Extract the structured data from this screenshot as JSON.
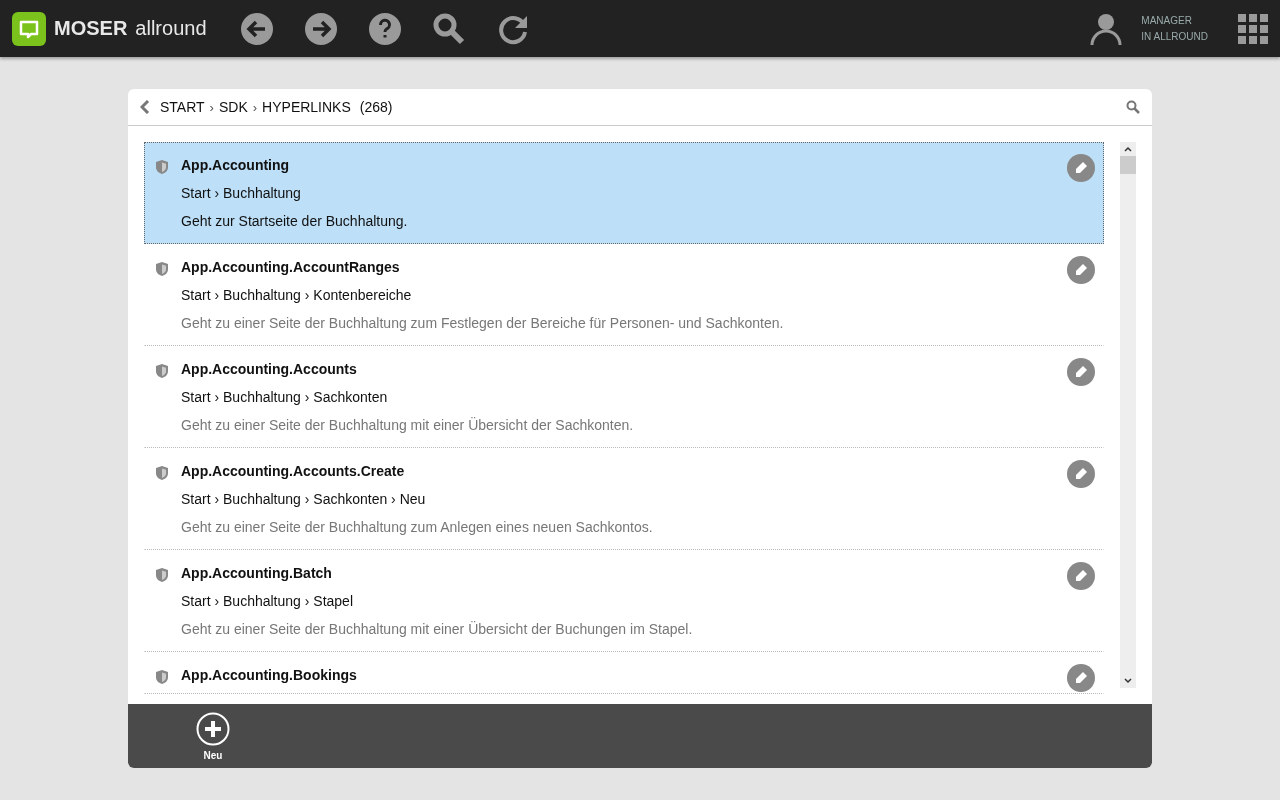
{
  "app": {
    "brand": "MOSER",
    "product": "allround"
  },
  "user": {
    "role": "MANAGER",
    "context": "IN ALLROUND"
  },
  "breadcrumb": {
    "separator": "›",
    "items": [
      "START",
      "SDK",
      "HYPERLINKS"
    ],
    "count": "(268)"
  },
  "rows": [
    {
      "title": "App.Accounting",
      "path": "Start › Buchhaltung",
      "description": "Geht zur Startseite der Buchhaltung.",
      "selected": true
    },
    {
      "title": "App.Accounting.AccountRanges",
      "path": "Start › Buchhaltung › Kontenbereiche",
      "description": "Geht zu einer Seite der Buchhaltung zum Festlegen der Bereiche für Personen- und Sachkonten.",
      "selected": false
    },
    {
      "title": "App.Accounting.Accounts",
      "path": "Start › Buchhaltung › Sachkonten",
      "description": "Geht zu einer Seite der Buchhaltung mit einer Übersicht der Sachkonten.",
      "selected": false
    },
    {
      "title": "App.Accounting.Accounts.Create",
      "path": "Start › Buchhaltung › Sachkonten › Neu",
      "description": "Geht zu einer Seite der Buchhaltung zum Anlegen eines neuen Sachkontos.",
      "selected": false
    },
    {
      "title": "App.Accounting.Batch",
      "path": "Start › Buchhaltung › Stapel",
      "description": "Geht zu einer Seite der Buchhaltung mit einer Übersicht der Buchungen im Stapel.",
      "selected": false
    },
    {
      "title": "App.Accounting.Bookings",
      "selected": false
    }
  ],
  "footer": {
    "actions": [
      {
        "label": "Neu"
      }
    ]
  }
}
